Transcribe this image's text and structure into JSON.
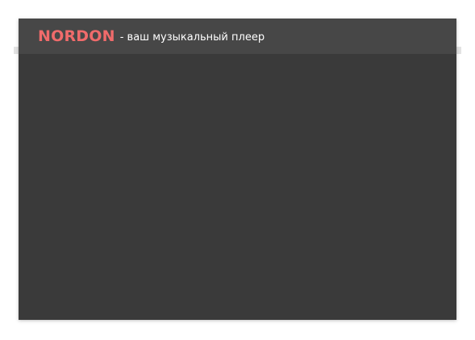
{
  "header": {
    "brand": "NORDON",
    "tagline": "- ваш музыкальный плеер"
  }
}
